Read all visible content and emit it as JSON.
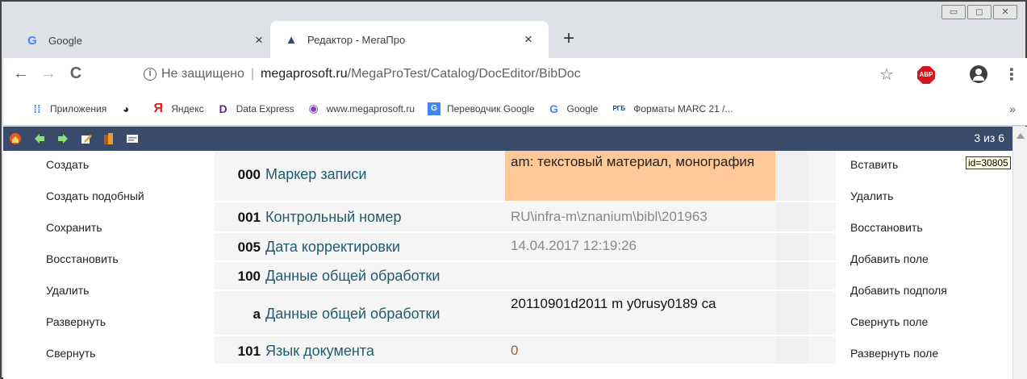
{
  "window_controls": [
    "▭",
    "◻",
    "✕"
  ],
  "tabs": [
    {
      "title": "Google",
      "close": "×",
      "favicon": "G"
    },
    {
      "title": "Редактор - МегаПро",
      "close": "×",
      "favicon": "▲"
    }
  ],
  "new_tab": "+",
  "toolbar": {
    "back": "←",
    "forward": "→",
    "reload": "C",
    "security_label": "Не защищено",
    "url_host": "megaprosoft.ru",
    "url_path": "/MegaProTest/Catalog/DocEditor/BibDoc",
    "abp_label": "ABP",
    "menu": "⋮",
    "star": "☆"
  },
  "bookmarks": [
    {
      "label": "Приложения",
      "icon": "apps-grid-icon",
      "glyph": "⁞⁞",
      "color": "#4285f4"
    },
    {
      "label": "",
      "icon": "globe-icon",
      "glyph": "◕",
      "color": "#333"
    },
    {
      "label": "Яндекс",
      "icon": "yandex-icon",
      "glyph": "Я",
      "color": "#e21d1d"
    },
    {
      "label": "Data Express",
      "icon": "data-express-icon",
      "glyph": "D",
      "color": "#5b2d91"
    },
    {
      "label": "www.megaprosoft.ru",
      "icon": "megaprosoft-icon",
      "glyph": "◉",
      "color": "#8a3fb8"
    },
    {
      "label": "Переводчик Google",
      "icon": "translate-icon",
      "glyph": "G",
      "color": "#4285f4"
    },
    {
      "label": "Google",
      "icon": "google-icon",
      "glyph": "G",
      "color": "#4285f4"
    },
    {
      "label": "Форматы MARC 21 /...",
      "icon": "rgb-icon",
      "glyph": "РГБ",
      "color": "#1a3c8a"
    }
  ],
  "bookmarks_more": "»",
  "app": {
    "counter": "3 из 6",
    "id_tooltip": "id=30805",
    "left_menu": [
      "Создать",
      "Создать подобный",
      "Сохранить",
      "Восстановить",
      "Удалить",
      "Развернуть",
      "Свернуть"
    ],
    "right_menu": [
      "Вставить",
      "Удалить",
      "Восстановить",
      "Добавить поле",
      "Добавить подполя",
      "Свернуть поле",
      "Развернуть поле"
    ],
    "fields": [
      {
        "num": "000",
        "label": "Маркер записи",
        "value": "am: текстовый материал, монография",
        "style": "hl"
      },
      {
        "num": "001",
        "label": "Контрольный номер",
        "value": "RU\\infra-m\\znanium\\bibl\\201963",
        "style": "grey"
      },
      {
        "num": "005",
        "label": "Дата корректировки",
        "value": "14.04.2017 12:19:26",
        "style": "grey"
      },
      {
        "num": "100",
        "label": "Данные общей обработки",
        "value": "",
        "style": "grey"
      },
      {
        "num": "a",
        "label": "Данные общей обработки",
        "value": "20110901d2011 m y0rusy0189 ca",
        "style": "dark"
      },
      {
        "num": "101",
        "label": "Язык документа",
        "value": "0",
        "style": "grey"
      }
    ]
  }
}
